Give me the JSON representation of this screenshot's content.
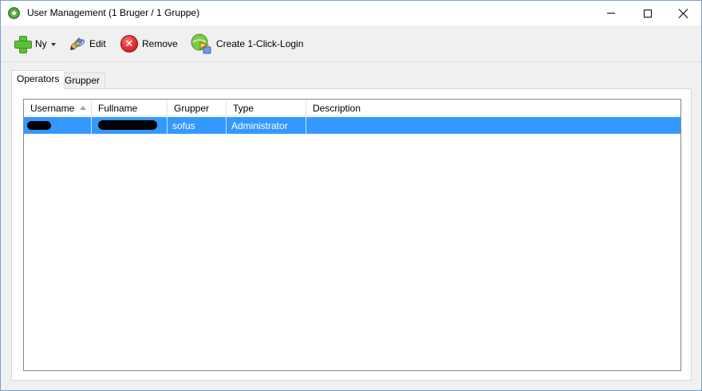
{
  "window": {
    "title": "User Management (1 Bruger / 1 Gruppe)"
  },
  "titlebar_buttons": {
    "minimize_icon": "minimize-icon",
    "maximize_icon": "maximize-icon",
    "close_icon": "close-icon"
  },
  "toolbar": {
    "new_label": "Ny",
    "edit_label": "Edit",
    "remove_label": "Remove",
    "login_label": "Create 1-Click-Login"
  },
  "tabs": [
    {
      "label": "Operators",
      "active": true
    },
    {
      "label": "Grupper",
      "active": false
    }
  ],
  "table": {
    "columns": [
      "Username",
      "Fullname",
      "Grupper",
      "Type",
      "Description"
    ],
    "sort_column": "Username",
    "rows": [
      {
        "username": "",
        "fullname": "",
        "grupper": "sofus",
        "type": "Administrator",
        "description": "",
        "selected": true
      }
    ]
  },
  "colors": {
    "selection": "#3399ff",
    "window_bg": "#f0f0f0",
    "accent_border": "#7a9fcf"
  }
}
